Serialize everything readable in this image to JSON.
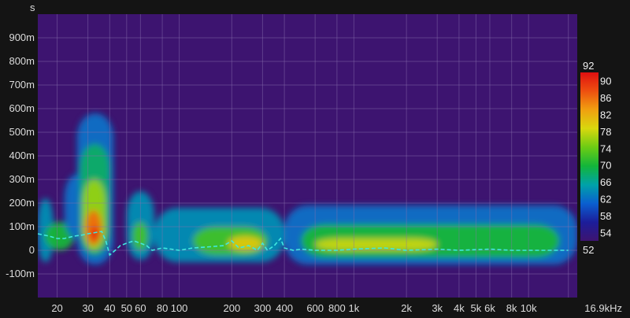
{
  "chart_data": {
    "type": "heatmap",
    "title": "",
    "ylabel": "s",
    "xlabel": "",
    "x_scale": "log",
    "xlim": [
      15.5,
      19000
    ],
    "ylim": [
      -0.2,
      1.0
    ],
    "grid": true,
    "background_color": "#3d1470",
    "x_ticks": [
      {
        "value": 20,
        "label": "20"
      },
      {
        "value": 30,
        "label": "30"
      },
      {
        "value": 40,
        "label": "40"
      },
      {
        "value": 50,
        "label": "50"
      },
      {
        "value": 60,
        "label": "60"
      },
      {
        "value": 80,
        "label": "80"
      },
      {
        "value": 100,
        "label": "100"
      },
      {
        "value": 200,
        "label": "200"
      },
      {
        "value": 300,
        "label": "300"
      },
      {
        "value": 400,
        "label": "400"
      },
      {
        "value": 600,
        "label": "600"
      },
      {
        "value": 800,
        "label": "800"
      },
      {
        "value": 1000,
        "label": "1k"
      },
      {
        "value": 2000,
        "label": "2k"
      },
      {
        "value": 3000,
        "label": "3k"
      },
      {
        "value": 4000,
        "label": "4k"
      },
      {
        "value": 5000,
        "label": "5k"
      },
      {
        "value": 6000,
        "label": "6k"
      },
      {
        "value": 8000,
        "label": "8k"
      },
      {
        "value": 10000,
        "label": "10k"
      },
      {
        "value": 16900,
        "label": "16.9kHz"
      }
    ],
    "y_ticks": [
      {
        "value": 0.9,
        "label": "900m"
      },
      {
        "value": 0.8,
        "label": "800m"
      },
      {
        "value": 0.7,
        "label": "700m"
      },
      {
        "value": 0.6,
        "label": "600m"
      },
      {
        "value": 0.5,
        "label": "500m"
      },
      {
        "value": 0.4,
        "label": "400m"
      },
      {
        "value": 0.3,
        "label": "300m"
      },
      {
        "value": 0.2,
        "label": "200m"
      },
      {
        "value": 0.1,
        "label": "100m"
      },
      {
        "value": 0.0,
        "label": "0"
      },
      {
        "value": -0.1,
        "label": "-100m"
      }
    ],
    "colorbar": {
      "min": 52,
      "max": 92,
      "min_label": "52",
      "max_label": "92",
      "ticks": [
        {
          "value": 90,
          "label": "90"
        },
        {
          "value": 86,
          "label": "86"
        },
        {
          "value": 82,
          "label": "82"
        },
        {
          "value": 78,
          "label": "78"
        },
        {
          "value": 74,
          "label": "74"
        },
        {
          "value": 70,
          "label": "70"
        },
        {
          "value": 66,
          "label": "66"
        },
        {
          "value": 62,
          "label": "62"
        },
        {
          "value": 58,
          "label": "58"
        },
        {
          "value": 54,
          "label": "54"
        }
      ],
      "color_stops": [
        "#3d1470",
        "#1c1d9a",
        "#0a5fd0",
        "#00a2a8",
        "#13b53a",
        "#6ccc14",
        "#d8d80e",
        "#f0a010",
        "#ee5010",
        "#e01010"
      ]
    },
    "regions": [
      {
        "f0": 15.5,
        "f1": 19,
        "t0": -0.05,
        "t1": 0.22,
        "level": 64
      },
      {
        "f0": 17,
        "f1": 25,
        "t0": 0.0,
        "t1": 0.12,
        "level": 70
      },
      {
        "f0": 22,
        "f1": 30,
        "t0": 0.05,
        "t1": 0.32,
        "level": 62
      },
      {
        "f0": 26,
        "f1": 42,
        "t0": -0.06,
        "t1": 0.58,
        "level": 62
      },
      {
        "f0": 27,
        "f1": 40,
        "t0": -0.02,
        "t1": 0.45,
        "level": 68
      },
      {
        "f0": 28,
        "f1": 38,
        "t0": 0.0,
        "t1": 0.3,
        "level": 76
      },
      {
        "f0": 29,
        "f1": 36,
        "t0": 0.02,
        "t1": 0.17,
        "level": 86
      },
      {
        "f0": 31,
        "f1": 35,
        "t0": 0.04,
        "t1": 0.1,
        "level": 90
      },
      {
        "f0": 50,
        "f1": 72,
        "t0": -0.04,
        "t1": 0.25,
        "level": 64
      },
      {
        "f0": 54,
        "f1": 66,
        "t0": 0.0,
        "t1": 0.12,
        "level": 72
      },
      {
        "f0": 72,
        "f1": 400,
        "t0": -0.05,
        "t1": 0.18,
        "level": 64
      },
      {
        "f0": 120,
        "f1": 320,
        "t0": -0.02,
        "t1": 0.1,
        "level": 72
      },
      {
        "f0": 190,
        "f1": 300,
        "t0": 0.0,
        "t1": 0.06,
        "level": 80
      },
      {
        "f0": 400,
        "f1": 19000,
        "t0": -0.06,
        "t1": 0.19,
        "level": 62
      },
      {
        "f0": 500,
        "f1": 15000,
        "t0": -0.03,
        "t1": 0.11,
        "level": 70
      },
      {
        "f0": 600,
        "f1": 3000,
        "t0": 0.0,
        "t1": 0.05,
        "level": 78
      }
    ],
    "series": [
      {
        "x": [
          15.5,
          18,
          20,
          22,
          25,
          28,
          30,
          33,
          36,
          38,
          40,
          43,
          46,
          50,
          55,
          60,
          65,
          70,
          80,
          90,
          100,
          120,
          150,
          180,
          200,
          220,
          250,
          280,
          300,
          320,
          350,
          380,
          400,
          450,
          500,
          600,
          800,
          1000,
          1500,
          2000,
          3000,
          4000,
          6000,
          8000,
          10000,
          16900
        ],
        "y": [
          0.07,
          0.06,
          0.05,
          0.05,
          0.06,
          0.065,
          0.07,
          0.075,
          0.08,
          0.04,
          -0.02,
          0.0,
          0.02,
          0.03,
          0.04,
          0.03,
          0.02,
          0.0,
          0.01,
          0.005,
          0.0,
          0.01,
          0.015,
          0.02,
          0.04,
          0.01,
          0.02,
          0.0,
          0.03,
          0.0,
          0.02,
          0.05,
          0.01,
          0.0,
          0.005,
          0.0,
          0.0,
          0.005,
          0.01,
          0.0,
          0.005,
          0.0,
          0.005,
          0.0,
          0.0,
          0.0
        ]
      }
    ]
  }
}
